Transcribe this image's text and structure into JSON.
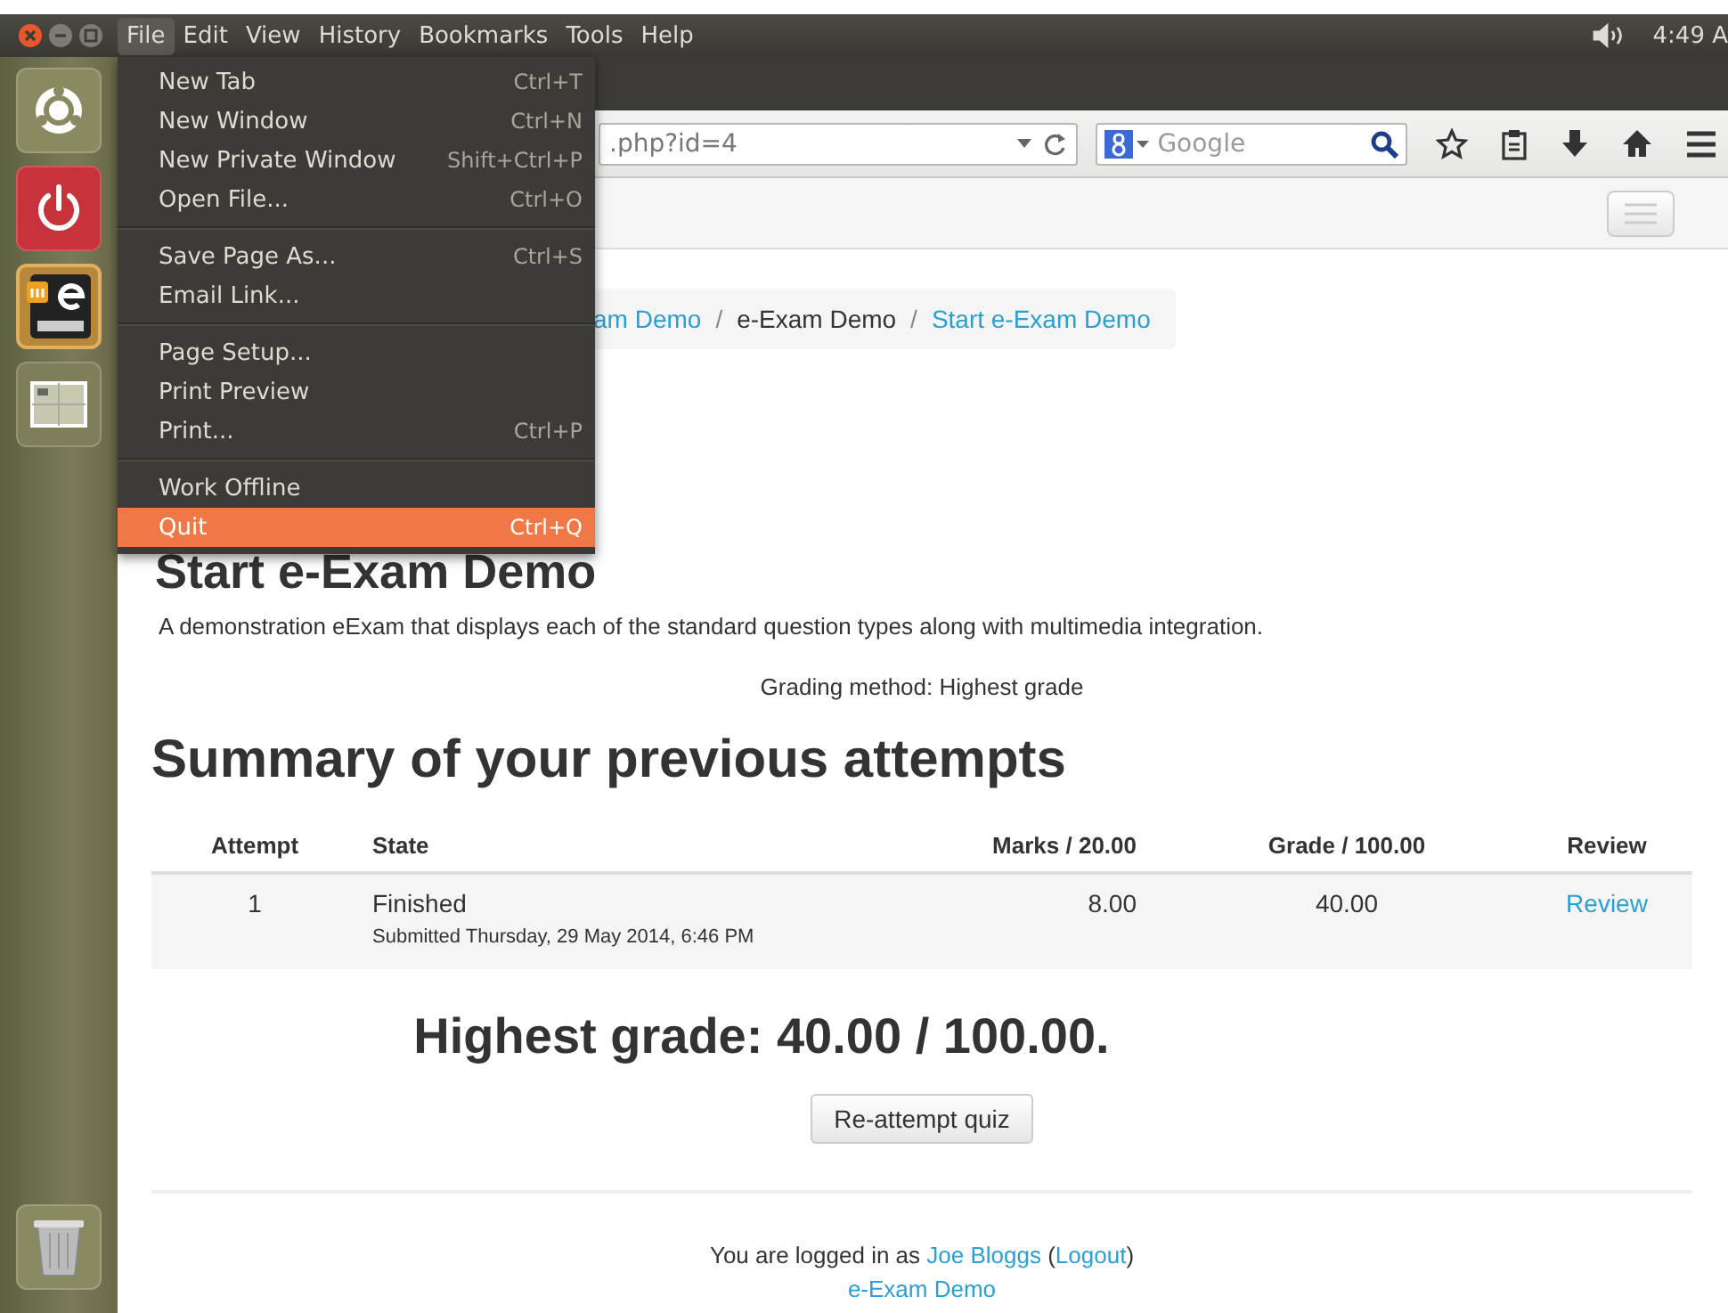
{
  "top_panel": {
    "menus": [
      {
        "label": "File",
        "selected": true
      },
      {
        "label": "Edit",
        "selected": false
      },
      {
        "label": "View",
        "selected": false
      },
      {
        "label": "History",
        "selected": false
      },
      {
        "label": "Bookmarks",
        "selected": false
      },
      {
        "label": "Tools",
        "selected": false
      },
      {
        "label": "Help",
        "selected": false
      }
    ],
    "clock": "4:49 A"
  },
  "launcher": [
    {
      "kind": "dash",
      "active": false
    },
    {
      "kind": "shutdown",
      "active": false
    },
    {
      "kind": "exam",
      "active": true
    },
    {
      "kind": "workspaces",
      "active": false
    },
    {
      "kind": "trash",
      "active": false
    }
  ],
  "browser": {
    "url": ".php?id=4",
    "search_placeholder": "Google"
  },
  "file_menu": [
    [
      {
        "label": "New Tab",
        "shortcut": "Ctrl+T",
        "selected": false
      },
      {
        "label": "New Window",
        "shortcut": "Ctrl+N",
        "selected": false
      },
      {
        "label": "New Private Window",
        "shortcut": "Shift+Ctrl+P",
        "selected": false
      },
      {
        "label": "Open File...",
        "shortcut": "Ctrl+O",
        "selected": false
      }
    ],
    [
      {
        "label": "Save Page As...",
        "shortcut": "Ctrl+S",
        "selected": false
      },
      {
        "label": "Email Link...",
        "selected": false
      }
    ],
    [
      {
        "label": "Page Setup...",
        "selected": false
      },
      {
        "label": "Print Preview",
        "selected": false
      },
      {
        "label": "Print...",
        "shortcut": "Ctrl+P",
        "selected": false
      }
    ],
    [
      {
        "label": "Work Offline",
        "selected": false
      },
      {
        "label": "Quit",
        "shortcut": "Ctrl+Q",
        "selected": true
      }
    ]
  ],
  "breadcrumb": {
    "separator": "/",
    "items": [
      {
        "label": "am Demo",
        "link": true
      },
      {
        "label": "e-Exam Demo",
        "link": false
      },
      {
        "label": "Start e-Exam Demo",
        "link": true
      }
    ]
  },
  "page": {
    "title": "Start e-Exam Demo",
    "description": "A demonstration eExam that displays each of the standard question types along with multimedia integration.",
    "grading": "Grading method: Highest grade",
    "summary_heading": "Summary of your previous attempts",
    "table": {
      "columns": [
        "Attempt",
        "State",
        "Marks / 20.00",
        "Grade / 100.00",
        "Review"
      ],
      "rows": [
        {
          "attempt": "1",
          "state": "Finished",
          "submitted": "Submitted Thursday, 29 May 2014, 6:46 PM",
          "marks": "8.00",
          "grade": "40.00",
          "review": "Review"
        }
      ]
    },
    "highest_grade": "Highest grade: 40.00 / 100.00.",
    "button": "Re-attempt quiz",
    "footer": {
      "login": [
        {
          "text": "You are logged in as ",
          "link": false
        },
        {
          "text": "Joe Bloggs",
          "link": true
        },
        {
          "text": " (",
          "link": false
        },
        {
          "text": "Logout",
          "link": true
        },
        {
          "text": ")",
          "link": false
        }
      ],
      "course_link": "e-Exam Demo"
    }
  }
}
